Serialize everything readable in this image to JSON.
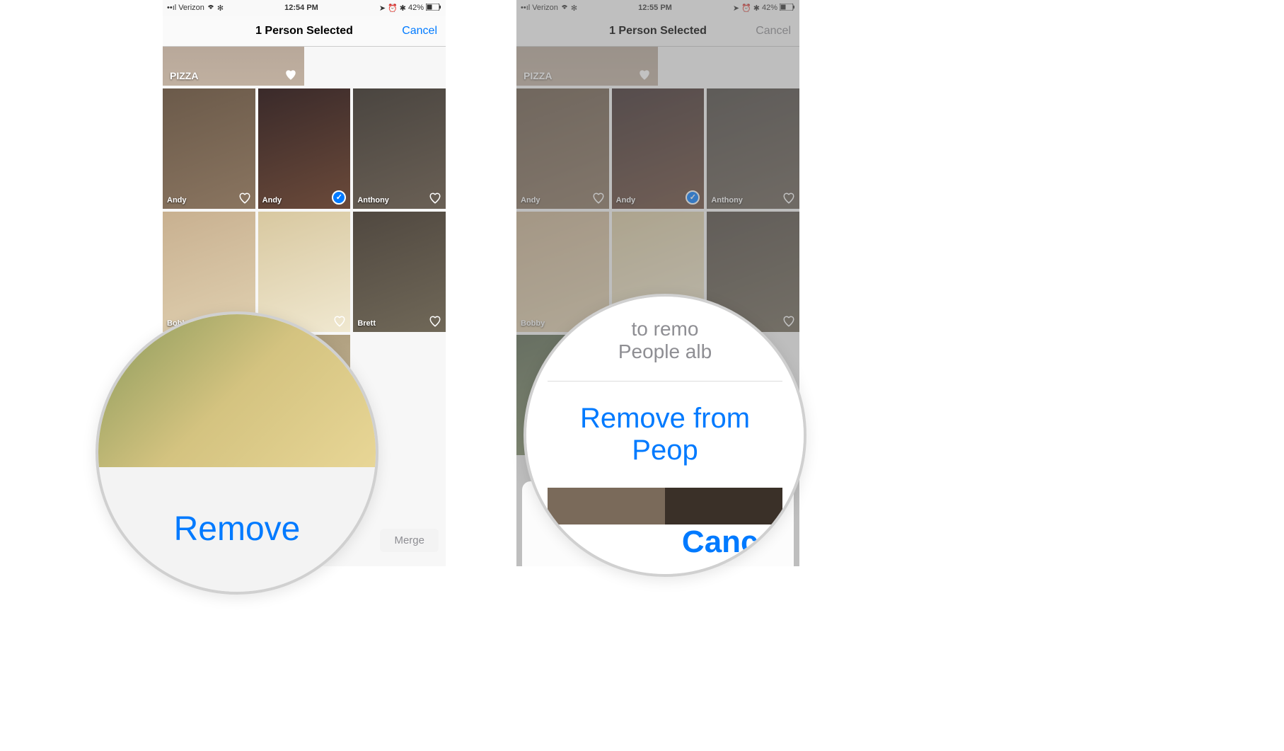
{
  "statusBar": {
    "carrier": "Verizon",
    "time1": "12:54 PM",
    "time2": "12:55 PM",
    "battery": "42%"
  },
  "navBar": {
    "title": "1 Person Selected",
    "cancel": "Cancel"
  },
  "pizzaTile": {
    "label": "PIZZA"
  },
  "people": [
    {
      "name": "Andy",
      "selected": false
    },
    {
      "name": "Andy",
      "selected": true
    },
    {
      "name": "Anthony",
      "selected": false
    },
    {
      "name": "Bobby",
      "selected": false
    },
    {
      "name": "",
      "selected": false
    },
    {
      "name": "Brett",
      "selected": false
    },
    {
      "name": "",
      "selected": false
    },
    {
      "name": "",
      "selected": false
    }
  ],
  "mergeButton": "Merge",
  "zoomLeft": {
    "button": "Remove"
  },
  "zoomRight": {
    "questionLine1": "to remo",
    "questionLine2": "People alb",
    "button": "Remove from Peop",
    "cancel": "Cance"
  }
}
